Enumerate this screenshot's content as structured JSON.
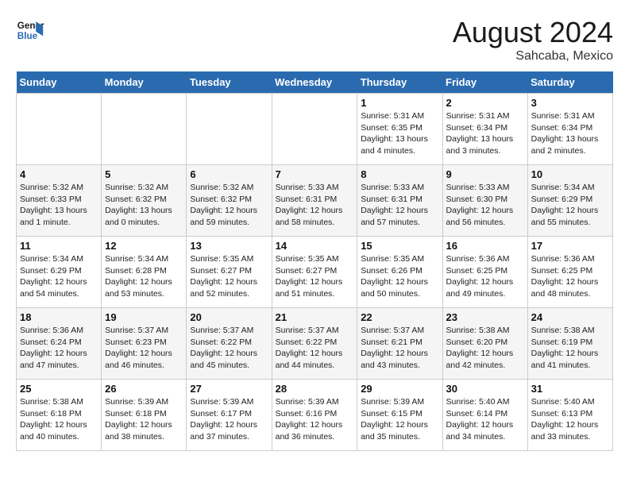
{
  "header": {
    "logo_line1": "General",
    "logo_line2": "Blue",
    "month_year": "August 2024",
    "location": "Sahcaba, Mexico"
  },
  "days_of_week": [
    "Sunday",
    "Monday",
    "Tuesday",
    "Wednesday",
    "Thursday",
    "Friday",
    "Saturday"
  ],
  "weeks": [
    [
      {
        "day": "",
        "info": ""
      },
      {
        "day": "",
        "info": ""
      },
      {
        "day": "",
        "info": ""
      },
      {
        "day": "",
        "info": ""
      },
      {
        "day": "1",
        "info": "Sunrise: 5:31 AM\nSunset: 6:35 PM\nDaylight: 13 hours\nand 4 minutes."
      },
      {
        "day": "2",
        "info": "Sunrise: 5:31 AM\nSunset: 6:34 PM\nDaylight: 13 hours\nand 3 minutes."
      },
      {
        "day": "3",
        "info": "Sunrise: 5:31 AM\nSunset: 6:34 PM\nDaylight: 13 hours\nand 2 minutes."
      }
    ],
    [
      {
        "day": "4",
        "info": "Sunrise: 5:32 AM\nSunset: 6:33 PM\nDaylight: 13 hours\nand 1 minute."
      },
      {
        "day": "5",
        "info": "Sunrise: 5:32 AM\nSunset: 6:32 PM\nDaylight: 13 hours\nand 0 minutes."
      },
      {
        "day": "6",
        "info": "Sunrise: 5:32 AM\nSunset: 6:32 PM\nDaylight: 12 hours\nand 59 minutes."
      },
      {
        "day": "7",
        "info": "Sunrise: 5:33 AM\nSunset: 6:31 PM\nDaylight: 12 hours\nand 58 minutes."
      },
      {
        "day": "8",
        "info": "Sunrise: 5:33 AM\nSunset: 6:31 PM\nDaylight: 12 hours\nand 57 minutes."
      },
      {
        "day": "9",
        "info": "Sunrise: 5:33 AM\nSunset: 6:30 PM\nDaylight: 12 hours\nand 56 minutes."
      },
      {
        "day": "10",
        "info": "Sunrise: 5:34 AM\nSunset: 6:29 PM\nDaylight: 12 hours\nand 55 minutes."
      }
    ],
    [
      {
        "day": "11",
        "info": "Sunrise: 5:34 AM\nSunset: 6:29 PM\nDaylight: 12 hours\nand 54 minutes."
      },
      {
        "day": "12",
        "info": "Sunrise: 5:34 AM\nSunset: 6:28 PM\nDaylight: 12 hours\nand 53 minutes."
      },
      {
        "day": "13",
        "info": "Sunrise: 5:35 AM\nSunset: 6:27 PM\nDaylight: 12 hours\nand 52 minutes."
      },
      {
        "day": "14",
        "info": "Sunrise: 5:35 AM\nSunset: 6:27 PM\nDaylight: 12 hours\nand 51 minutes."
      },
      {
        "day": "15",
        "info": "Sunrise: 5:35 AM\nSunset: 6:26 PM\nDaylight: 12 hours\nand 50 minutes."
      },
      {
        "day": "16",
        "info": "Sunrise: 5:36 AM\nSunset: 6:25 PM\nDaylight: 12 hours\nand 49 minutes."
      },
      {
        "day": "17",
        "info": "Sunrise: 5:36 AM\nSunset: 6:25 PM\nDaylight: 12 hours\nand 48 minutes."
      }
    ],
    [
      {
        "day": "18",
        "info": "Sunrise: 5:36 AM\nSunset: 6:24 PM\nDaylight: 12 hours\nand 47 minutes."
      },
      {
        "day": "19",
        "info": "Sunrise: 5:37 AM\nSunset: 6:23 PM\nDaylight: 12 hours\nand 46 minutes."
      },
      {
        "day": "20",
        "info": "Sunrise: 5:37 AM\nSunset: 6:22 PM\nDaylight: 12 hours\nand 45 minutes."
      },
      {
        "day": "21",
        "info": "Sunrise: 5:37 AM\nSunset: 6:22 PM\nDaylight: 12 hours\nand 44 minutes."
      },
      {
        "day": "22",
        "info": "Sunrise: 5:37 AM\nSunset: 6:21 PM\nDaylight: 12 hours\nand 43 minutes."
      },
      {
        "day": "23",
        "info": "Sunrise: 5:38 AM\nSunset: 6:20 PM\nDaylight: 12 hours\nand 42 minutes."
      },
      {
        "day": "24",
        "info": "Sunrise: 5:38 AM\nSunset: 6:19 PM\nDaylight: 12 hours\nand 41 minutes."
      }
    ],
    [
      {
        "day": "25",
        "info": "Sunrise: 5:38 AM\nSunset: 6:18 PM\nDaylight: 12 hours\nand 40 minutes."
      },
      {
        "day": "26",
        "info": "Sunrise: 5:39 AM\nSunset: 6:18 PM\nDaylight: 12 hours\nand 38 minutes."
      },
      {
        "day": "27",
        "info": "Sunrise: 5:39 AM\nSunset: 6:17 PM\nDaylight: 12 hours\nand 37 minutes."
      },
      {
        "day": "28",
        "info": "Sunrise: 5:39 AM\nSunset: 6:16 PM\nDaylight: 12 hours\nand 36 minutes."
      },
      {
        "day": "29",
        "info": "Sunrise: 5:39 AM\nSunset: 6:15 PM\nDaylight: 12 hours\nand 35 minutes."
      },
      {
        "day": "30",
        "info": "Sunrise: 5:40 AM\nSunset: 6:14 PM\nDaylight: 12 hours\nand 34 minutes."
      },
      {
        "day": "31",
        "info": "Sunrise: 5:40 AM\nSunset: 6:13 PM\nDaylight: 12 hours\nand 33 minutes."
      }
    ]
  ]
}
